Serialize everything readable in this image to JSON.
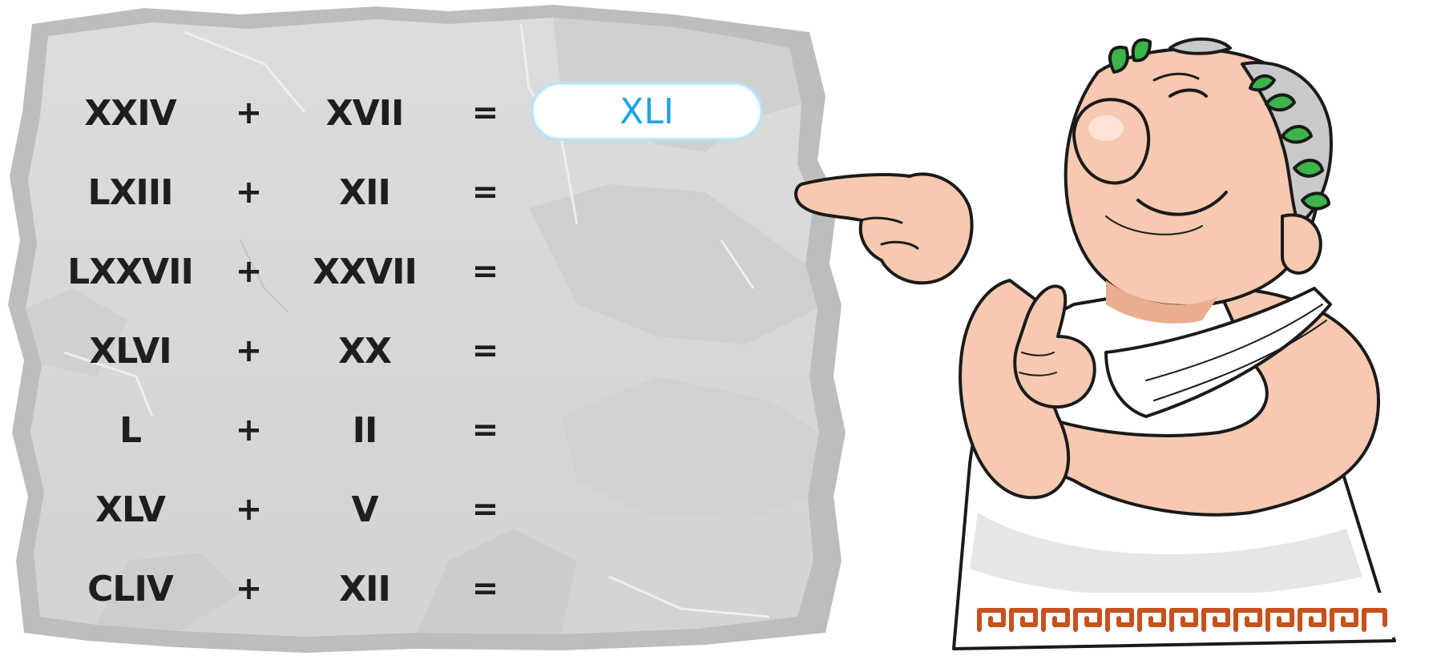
{
  "equations": [
    {
      "a": "XXIV",
      "op": "+",
      "b": "XVII",
      "eq": "="
    },
    {
      "a": "LXIII",
      "op": "+",
      "b": "XII",
      "eq": "="
    },
    {
      "a": "LXXVII",
      "op": "+",
      "b": "XXVII",
      "eq": "="
    },
    {
      "a": "XLVI",
      "op": "+",
      "b": "XX",
      "eq": "="
    },
    {
      "a": "L",
      "op": "+",
      "b": "II",
      "eq": "="
    },
    {
      "a": "XLV",
      "op": "+",
      "b": "V",
      "eq": "="
    },
    {
      "a": "CLIV",
      "op": "+",
      "b": "XII",
      "eq": "="
    }
  ],
  "answers": [
    "XLI",
    "",
    "",
    "",
    "",
    "",
    ""
  ],
  "colors": {
    "stone": "#d9d9d9",
    "stone_dark": "#bdbdbd",
    "text": "#1e1e1e",
    "answer_text": "#1fa3e3",
    "answer_border": "#b5e3f7",
    "skin": "#f6c9b0",
    "laurel": "#3bb54a",
    "toga_pattern": "#c8511b"
  },
  "icons": [
    "stone-tablet",
    "roman-emperor-mascot"
  ]
}
